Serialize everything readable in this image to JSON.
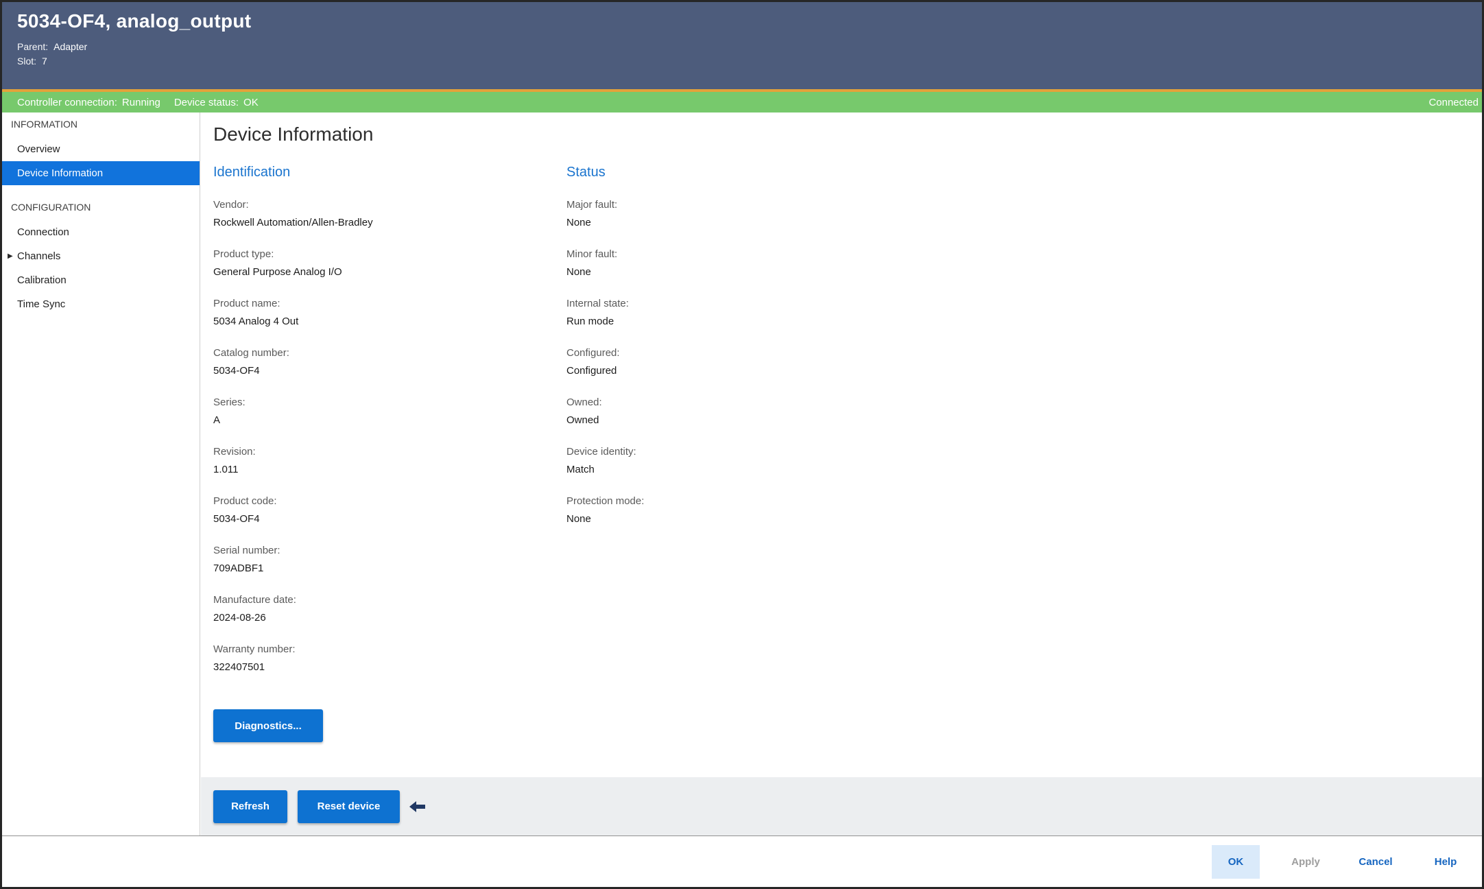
{
  "header": {
    "title": "5034-OF4, analog_output",
    "parent_label": "Parent:",
    "parent_value": "Adapter",
    "slot_label": "Slot:",
    "slot_value": "7"
  },
  "status_bar": {
    "controller_connection_label": "Controller connection:",
    "controller_connection_value": "Running",
    "device_status_label": "Device status:",
    "device_status_value": "OK",
    "connected_text": "Connected"
  },
  "sidebar": {
    "sections": [
      {
        "title": "INFORMATION",
        "items": [
          {
            "label": "Overview",
            "selected": false
          },
          {
            "label": "Device Information",
            "selected": true
          }
        ]
      },
      {
        "title": "CONFIGURATION",
        "items": [
          {
            "label": "Connection"
          },
          {
            "label": "Channels",
            "expandable": true
          },
          {
            "label": "Calibration"
          },
          {
            "label": "Time Sync"
          }
        ]
      }
    ]
  },
  "main": {
    "title": "Device Information",
    "identification": {
      "title": "Identification",
      "fields": [
        {
          "label": "Vendor:",
          "value": "Rockwell Automation/Allen-Bradley"
        },
        {
          "label": "Product type:",
          "value": "General Purpose Analog I/O"
        },
        {
          "label": "Product name:",
          "value": "5034 Analog 4 Out"
        },
        {
          "label": "Catalog number:",
          "value": "5034-OF4"
        },
        {
          "label": "Series:",
          "value": "A"
        },
        {
          "label": "Revision:",
          "value": "1.011"
        },
        {
          "label": "Product code:",
          "value": "5034-OF4"
        },
        {
          "label": "Serial number:",
          "value": "709ADBF1"
        },
        {
          "label": "Manufacture date:",
          "value": "2024-08-26"
        },
        {
          "label": "Warranty number:",
          "value": "322407501"
        }
      ]
    },
    "status": {
      "title": "Status",
      "fields": [
        {
          "label": "Major fault:",
          "value": "None"
        },
        {
          "label": "Minor fault:",
          "value": "None"
        },
        {
          "label": "Internal state:",
          "value": "Run mode"
        },
        {
          "label": "Configured:",
          "value": "Configured"
        },
        {
          "label": "Owned:",
          "value": "Owned"
        },
        {
          "label": "Device identity:",
          "value": "Match"
        },
        {
          "label": "Protection mode:",
          "value": "None"
        }
      ]
    },
    "diagnostics_button_label": "Diagnostics..."
  },
  "action_bar": {
    "refresh_label": "Refresh",
    "reset_device_label": "Reset device"
  },
  "footer": {
    "ok_label": "OK",
    "apply_label": "Apply",
    "cancel_label": "Cancel",
    "help_label": "Help"
  },
  "icons": {
    "channels_expander": "expand-triangle",
    "annotation_arrow": "left-arrow"
  },
  "colors": {
    "header_bg": "#4d5c7c",
    "gold_divider": "#e3a23a",
    "status_green": "#77c96c",
    "accent_blue": "#0e72d1",
    "selected_item_blue": "#1173dc",
    "section_heading_blue": "#1a74ce",
    "footer_link_blue": "#1565c0",
    "annotation_arrow_navy": "#203864"
  }
}
